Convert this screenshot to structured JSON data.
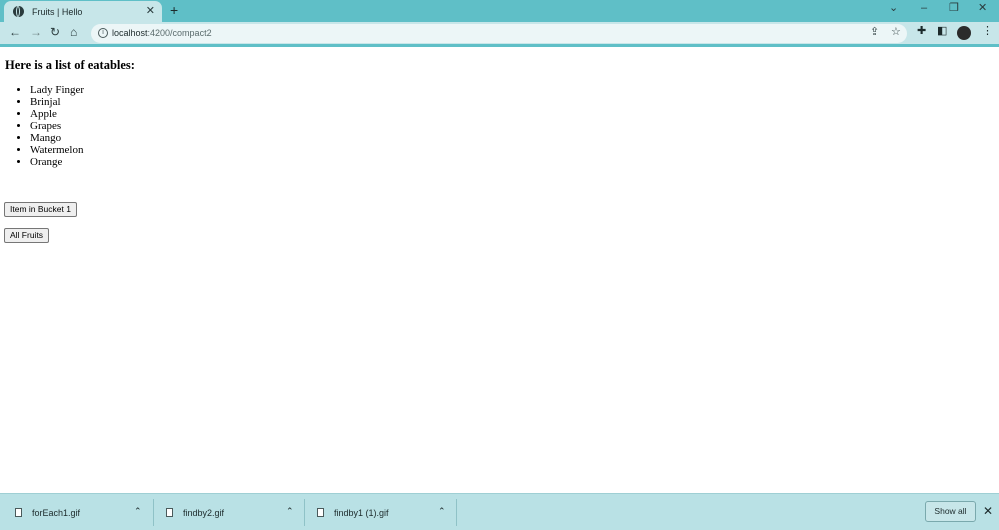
{
  "browser": {
    "tab_title": "Fruits | Hello",
    "url_host": "localhost",
    "url_rest": ":4200/compact2",
    "icons": [
      "globe-icon",
      "close-icon",
      "plus-icon",
      "back-icon",
      "forward-icon",
      "reload-icon",
      "home-icon",
      "info-icon",
      "share-icon",
      "star-icon",
      "extensions-icon",
      "sidebar-icon",
      "profile-avatar",
      "menu-icon",
      "minimize-icon",
      "restore-icon",
      "window-close-icon",
      "tab-search-icon"
    ]
  },
  "page": {
    "heading": "Here is a list of eatables:",
    "items": [
      "Lady Finger",
      "Brinjal",
      "Apple",
      "Grapes",
      "Mango",
      "Watermelon",
      "Orange"
    ],
    "button_bucket": "Item in Bucket 1",
    "button_all": "All Fruits"
  },
  "downloads": {
    "files": [
      "forEach1.gif",
      "findby2.gif",
      "findby1 (1).gif"
    ],
    "show_all": "Show all"
  },
  "colors": {
    "tabstrip": "#5fbfc7",
    "toolbar": "#c7e6e9",
    "shelf": "#b9e1e5"
  }
}
